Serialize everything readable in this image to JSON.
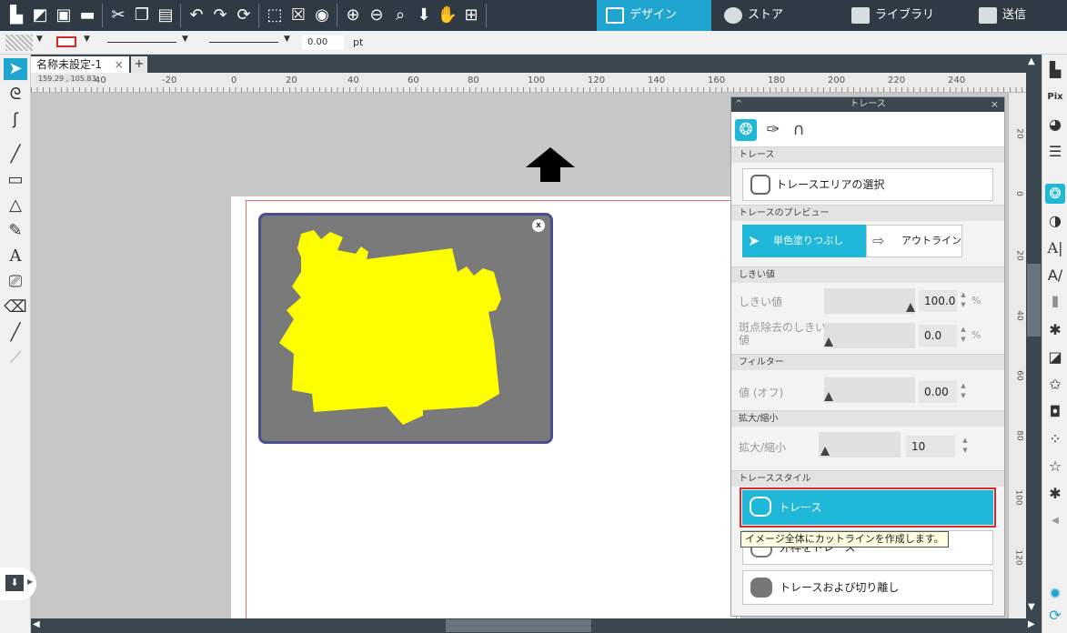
{
  "topbar": {
    "tabs": [
      {
        "label": "デザイン",
        "icon": "grid-icon"
      },
      {
        "label": "ストア",
        "icon": "store-icon"
      },
      {
        "label": "ライブラリ",
        "icon": "library-icon"
      },
      {
        "label": "送信",
        "icon": "send-icon"
      }
    ]
  },
  "stylebar": {
    "line_width": "0.00",
    "unit": "pt"
  },
  "document": {
    "tab_title": "名称未設定-1",
    "tab_close": "×",
    "tab_add": "+"
  },
  "ruler": {
    "cursor_coords": "159.29 , 105.83",
    "ticks": [
      "40",
      "-20",
      "0",
      "20",
      "40",
      "60",
      "80",
      "100",
      "120",
      "140",
      "160",
      "180",
      "200",
      "220",
      "240"
    ],
    "vticks": [
      "20",
      "0",
      "20",
      "40",
      "60",
      "80",
      "100",
      "120"
    ]
  },
  "canvas": {
    "image_close": "x"
  },
  "trace_panel": {
    "title": "トレース",
    "collapse": "^",
    "close": "×",
    "sections": {
      "trace": "トレース",
      "preview": "トレースのプレビュー",
      "threshold": "しきい値",
      "filter": "フィルター",
      "scale": "拡大/縮小",
      "trace_style": "トレーススタイル"
    },
    "select_area_button": "トレースエリアの選択",
    "preview_mono": "単色塗りつぶし",
    "preview_outline": "アウトライン",
    "threshold_label": "しきい値",
    "threshold_value": "100.0",
    "threshold_unit": "%",
    "despeckle_label": "斑点除去のしきい値",
    "despeckle_value": "0.0",
    "despeckle_unit": "%",
    "filter_label": "値 (オフ)",
    "filter_value": "0.00",
    "scale_label": "拡大/縮小",
    "scale_value": "10",
    "style_trace": "トレース",
    "style_outer": "外枠をトレース",
    "style_detach": "トレースおよび切り離し",
    "tooltip": "イメージ全体にカットラインを作成します。"
  },
  "colors": {
    "toolbar_bg": "#2f3a44",
    "accent": "#1fb8d8",
    "trace_yellow": "#ffff00",
    "highlight_red": "#d42a2a"
  }
}
